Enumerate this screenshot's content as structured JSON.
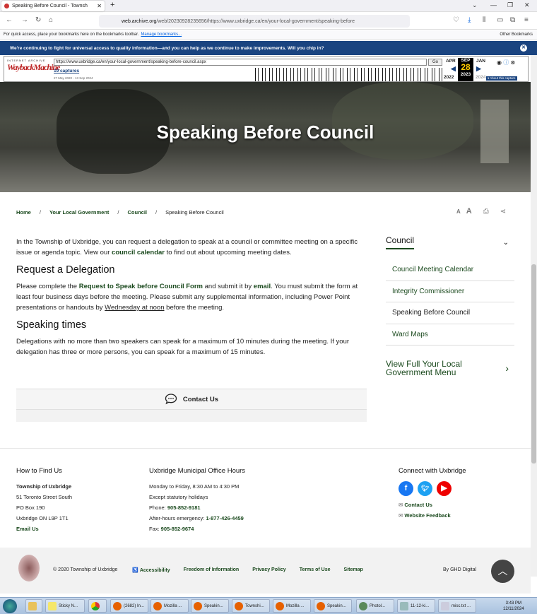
{
  "browser": {
    "tab_title": "Speaking Before Council - Townsh",
    "url_domain": "web.archive.org",
    "url_rest": "/web/20230928235656/https://www.uxbridge.ca/en/your-local-government/speaking-before",
    "bookmarks_text": "For quick access, place your bookmarks here on the bookmarks toolbar.",
    "bookmarks_link": "Manage bookmarks...",
    "other_bookmarks": "Other Bookmarks"
  },
  "wayback": {
    "banner": "We're continuing to fight for universal access to quality information—and you can help as we continue to make improvements. Will you chip in?",
    "logo_top": "INTERNET ARCHIVE",
    "logo_main": "WaybackMachine",
    "url": "https://www.uxbridge.ca/en/your-local-government/speaking-before-council.aspx",
    "go": "Go",
    "captures": "19 captures",
    "range": "27 May 2020 - 13 Sep 2024",
    "month_prev": "APR",
    "month_cur": "SEP",
    "month_next": "JAN",
    "day": "28",
    "year_prev": "2022",
    "year_cur": "2023",
    "year_next": "2024",
    "about": "▾ About this capture"
  },
  "hero": {
    "title": "Speaking Before Council"
  },
  "breadcrumb": {
    "home": "Home",
    "level1": "Your Local Government",
    "level2": "Council",
    "current": "Speaking Before Council",
    "sep": "/"
  },
  "content": {
    "intro_a": "In the Township of Uxbridge, you can request a delegation to speak at a council or committee meeting on a specific issue or agenda topic. View our ",
    "intro_link": "council calendar",
    "intro_b": " to find out about upcoming meeting dates.",
    "h_request": "Request a Delegation",
    "req_a": "Please complete the ",
    "req_link1": "Request to Speak before Council Form",
    "req_b": " and submit it by ",
    "req_link2": "email",
    "req_c": ". You must submit the form at least four business days before the meeting. Please submit any supplemental information, including Power Point presentations or handouts by ",
    "req_u": "Wednesday at noon",
    "req_d": " before the meeting.",
    "h_times": "Speaking times",
    "times": "Delegations with no more than two speakers can speak for a maximum of 10 minutes during the meeting. If your delegation has three or more persons, you can speak for a maximum of 15 minutes.",
    "contact": "Contact Us"
  },
  "sidebar": {
    "title": "Council",
    "items": [
      {
        "label": "Council Meeting Calendar"
      },
      {
        "label": "Integrity Commissioner"
      },
      {
        "label": "Speaking Before Council"
      },
      {
        "label": "Ward Maps"
      }
    ],
    "full_menu": "View Full Your Local Government Menu"
  },
  "footer": {
    "find_title": "How to Find Us",
    "org": "Township of Uxbridge",
    "addr1": "51 Toronto Street South",
    "addr2": "PO Box 190",
    "addr3": "Uxbridge ON L9P 1T1",
    "email": "Email Us",
    "hours_title": "Uxbridge Municipal Office Hours",
    "hours1": "Monday to Friday, 8:30 AM to 4:30 PM",
    "hours2": "Except statutory holidays",
    "phone_label": "Phone: ",
    "phone": "905-852-9181",
    "ah_label": "After-hours emergency: ",
    "ah": "1-877-426-4459",
    "fax_label": "Fax: ",
    "fax": "905-852-9674",
    "connect_title": "Connect with Uxbridge",
    "contact_link": "Contact Us",
    "feedback_link": "Website Feedback",
    "copyright": "© 2020 Township of Uxbridge",
    "accessibility": "Accessibility",
    "foi": "Freedom of Information",
    "privacy": "Privacy Policy",
    "terms": "Terms of Use",
    "sitemap": "Sitemap",
    "credit": "By GHD Digital"
  },
  "taskbar": {
    "items": [
      "Sticky N...",
      "",
      "(2682) In...",
      "Mozilla ...",
      "Speakin...",
      "Townshi...",
      "Mozilla ...",
      "Speakin...",
      "Photol...",
      "11-12-ki...",
      "misc.txt ..."
    ],
    "time": "3:43 PM",
    "date": "12/11/2024"
  },
  "colors": {
    "accent": "#1b4a1e",
    "wayback_blue": "#1a4480",
    "hero": "#3d3e38"
  }
}
